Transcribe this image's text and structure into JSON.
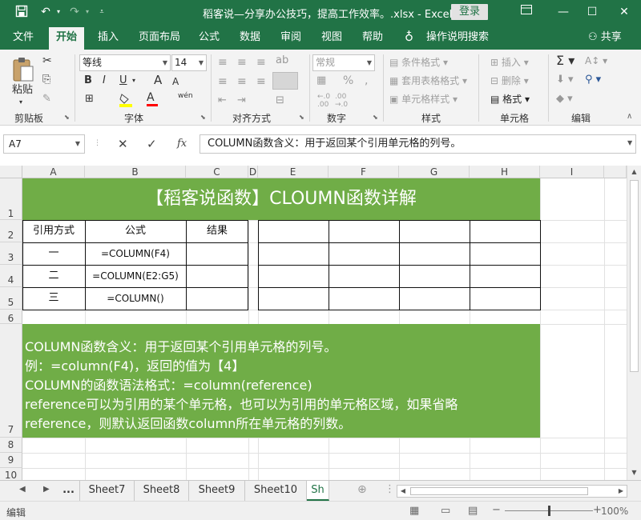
{
  "titlebar": {
    "title": "稻客说—分享办公技巧，提高工作效率。.xlsx  -  Excel",
    "login": "登录",
    "save_icon": "save-icon",
    "undo_icon": "undo-icon",
    "redo_icon": "redo-icon",
    "customize_icon": "customize-qat-icon",
    "ribbon_display_icon": "ribbon-display-options-icon"
  },
  "tabs": [
    "文件",
    "开始",
    "插入",
    "页面布局",
    "公式",
    "数据",
    "审阅",
    "视图",
    "帮助"
  ],
  "tell_me": "操作说明搜索",
  "share": "共享",
  "ribbon": {
    "clipboard": {
      "label": "剪贴板",
      "paste": "粘贴"
    },
    "font": {
      "label": "字体",
      "font_name": "等线",
      "font_size": "14",
      "bold": "B",
      "italic": "I",
      "underline": "U",
      "grow": "A",
      "shrink": "A",
      "font_color": "A",
      "phonetic": "wén"
    },
    "alignment": {
      "label": "对齐方式"
    },
    "number": {
      "label": "数字",
      "format": "常规",
      "percent": "%",
      "comma": ",",
      "inc_decimal": ".00 →.0",
      "dec_decimal": ".00 →.0"
    },
    "styles": {
      "label": "样式",
      "conditional": "条件格式",
      "table": "套用表格格式",
      "cell_styles": "单元格样式"
    },
    "cells": {
      "label": "单元格",
      "insert": "插入",
      "delete": "删除",
      "format": "格式"
    },
    "editing": {
      "label": "编辑"
    }
  },
  "formula_bar": {
    "name_box": "A7",
    "fx": "fx",
    "formula": "COLUMN函数含义：用于返回某个引用单元格的列号。"
  },
  "grid": {
    "columns": [
      "A",
      "B",
      "C",
      "D",
      "E",
      "F",
      "G",
      "H",
      "I"
    ],
    "rows": [
      "1",
      "2",
      "3",
      "4",
      "5",
      "6",
      "7",
      "8",
      "9",
      "10"
    ],
    "banner_title": "【稻客说函数】CLOUMN函数详解",
    "headers": [
      "引用方式",
      "公式",
      "结果"
    ],
    "table_rows": [
      {
        "mode": "一",
        "formula": "=COLUMN(F4)",
        "result": ""
      },
      {
        "mode": "二",
        "formula": "=COLUMN(E2:G5)",
        "result": ""
      },
      {
        "mode": "三",
        "formula": "=COLUMN()",
        "result": ""
      }
    ],
    "description": [
      "COLUMN函数含义：用于返回某个引用单元格的列号。",
      "例：=column(F4)，返回的值为【4】",
      "COLUMN的函数语法格式：=column(reference)",
      "reference可以为引用的某个单元格，也可以为引用的单元格区域，如果省略",
      "reference，则默认返回函数column所在单元格的列数。"
    ],
    "band_color": "#70ad47"
  },
  "sheet_tabs": {
    "ellipsis": "...",
    "tabs": [
      "Sheet7",
      "Sheet8",
      "Sheet9",
      "Sheet10",
      "Sh"
    ],
    "active_index": 4
  },
  "status": {
    "mode": "编辑",
    "zoom": "100%"
  },
  "colors": {
    "excel_green": "#217346",
    "accent_green": "#70ad47"
  }
}
